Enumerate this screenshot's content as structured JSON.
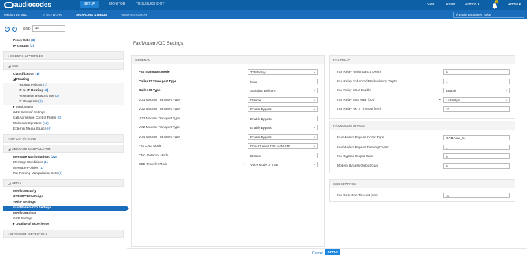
{
  "topbar": {
    "logo": "audiocodes",
    "nav": [
      "SETUP",
      "MONITOR",
      "TROUBLESHOOT"
    ],
    "right": [
      "Save",
      "Reset",
      "Actions ▾",
      "Admin ▾"
    ],
    "bell_count": "0"
  },
  "subbar": {
    "device": "Mediant VE SBC",
    "tabs": [
      "IP NETWORK",
      "SIGNALING & MEDIA",
      "ADMINISTRATION"
    ],
    "search_placeholder": "Entity, parameter, value"
  },
  "filter": {
    "srd_label": "SRD",
    "srd_value": "All"
  },
  "sidebar": {
    "top_items": [
      {
        "label": "Proxy Sets",
        "count": "(3)"
      },
      {
        "label": "IP Groups",
        "count": "(3)"
      }
    ],
    "groups": {
      "codecs": "CODERS & PROFILES",
      "sbc": "SBC",
      "sip": "SIP DEFINITIONS",
      "msg": "MESSAGE MANIPULATION",
      "media": "MEDIA",
      "intrusion": "INTRUSION DETECTION"
    },
    "sbc_items": [
      {
        "label": "Classification",
        "count": "(1)",
        "style": "b"
      },
      {
        "label": "◢ Routing",
        "count": "",
        "style": "b"
      },
      {
        "label": "Routing Policies",
        "count": "(1)",
        "style": "sub2"
      },
      {
        "label": "IP-to-IP Routing",
        "count": "(6)",
        "style": "sub2 b"
      },
      {
        "label": "Alternative Reasons Set",
        "count": "(0)",
        "style": "sub2"
      },
      {
        "label": "IP Group Set",
        "count": "(0)",
        "style": "sub2"
      },
      {
        "label": "▸ Manipulation",
        "count": "",
        "style": ""
      },
      {
        "label": "SBC General Settings",
        "count": "",
        "style": "i"
      },
      {
        "label": "Call Admission Control Profile",
        "count": "(0)",
        "style": ""
      },
      {
        "label": "Malicious Signature",
        "count": "(12)",
        "style": ""
      },
      {
        "label": "External Media Source",
        "count": "(0)",
        "style": ""
      }
    ],
    "msg_items": [
      {
        "label": "Message Manipulations",
        "count": "(22)",
        "style": "b"
      },
      {
        "label": "Message Conditions",
        "count": "(1)",
        "style": ""
      },
      {
        "label": "Message Policies",
        "count": "(1)",
        "style": ""
      },
      {
        "label": "Pre-Parsing Manipulation Sets",
        "count": "(0)",
        "style": ""
      }
    ],
    "media_items": [
      {
        "label": "Media Security",
        "count": "",
        "style": "i b"
      },
      {
        "label": "RTP/RTCP Settings",
        "count": "",
        "style": "i b"
      },
      {
        "label": "Voice Settings",
        "count": "",
        "style": "i b"
      },
      {
        "label": "Fax/Modem/CID Settings",
        "count": "",
        "style": "active"
      },
      {
        "label": "Media Settings",
        "count": "",
        "style": "i b"
      },
      {
        "label": "DSP Settings",
        "count": "",
        "style": "i"
      },
      {
        "label": "▸ Quality of Experience",
        "count": "",
        "style": "b"
      }
    ]
  },
  "page_title": "Fax/Modem/CID Settings",
  "general": {
    "heading": "GENERAL",
    "rows": [
      {
        "label": "Fax Transport Mode",
        "value": "T.38 Relay",
        "bold": true,
        "bullet": false
      },
      {
        "label": "Caller ID Transport Type",
        "value": "Mute",
        "bold": true,
        "bullet": false
      },
      {
        "label": "Caller ID Type",
        "value": "Standard Bellcore",
        "bold": true,
        "bullet": false
      },
      {
        "label": "V.21 Modem Transport Type",
        "value": "Disable",
        "bold": false,
        "bullet": false
      },
      {
        "label": "V.22 Modem Transport Type",
        "value": "Enable Bypass",
        "bold": false,
        "bullet": false
      },
      {
        "label": "V.23 Modem Transport Type",
        "value": "Enable Bypass",
        "bold": false,
        "bullet": false
      },
      {
        "label": "V.32 Modem Transport Type",
        "value": "Enable Bypass",
        "bold": false,
        "bullet": false
      },
      {
        "label": "V.34 Modem Transport Type",
        "value": "Enable Bypass",
        "bold": false,
        "bullet": false
      },
      {
        "label": "Fax CNG Mode",
        "value": "Doesn't send T.38 re-INVITE",
        "bold": false,
        "bullet": false
      },
      {
        "label": "CNG Detector Mode",
        "value": "Disable",
        "bold": false,
        "bullet": false
      },
      {
        "label": "CED Transfer Mode",
        "value": "Voice Mode or VBD",
        "bold": false,
        "bullet": true
      }
    ]
  },
  "fax_relay": {
    "heading": "FAX RELAY",
    "rows": [
      {
        "label": "Fax Relay Redundancy Depth",
        "value": "0",
        "kind": "input",
        "bullet": false
      },
      {
        "label": "Fax Relay Enhanced Redundancy Depth",
        "value": "4",
        "kind": "input",
        "bullet": false
      },
      {
        "label": "Fax Relay ECM Enable",
        "value": "Enable",
        "kind": "select",
        "bullet": false
      },
      {
        "label": "Fax Relay Max Rate (bps)",
        "value": "14400bps",
        "kind": "select",
        "bullet": true
      },
      {
        "label": "Fax Relay RxTx Timeout [sec]",
        "value": "10",
        "kind": "input",
        "bullet": false
      }
    ]
  },
  "bypass": {
    "heading": "FAX/MODEM BYPASS",
    "rows": [
      {
        "label": "Fax/Modem Bypass Coder Type",
        "value": "G711Alaw_64",
        "kind": "select",
        "bullet": false
      },
      {
        "label": "Fax/Modem Bypass Packing Factor",
        "value": "1",
        "kind": "input",
        "bullet": false
      },
      {
        "label": "Fax Bypass Output Gain",
        "value": "0",
        "kind": "input",
        "bullet": false
      },
      {
        "label": "Modem Bypass Output Gain",
        "value": "0",
        "kind": "input",
        "bullet": false
      }
    ]
  },
  "sbc_settings": {
    "heading": "SBC SETTINGS",
    "rows": [
      {
        "label": "Fax Detection Timeout [sec]",
        "value": "10",
        "kind": "input",
        "bullet": false
      }
    ]
  },
  "footer": {
    "cancel": "Cancel",
    "apply": "APPLY"
  }
}
